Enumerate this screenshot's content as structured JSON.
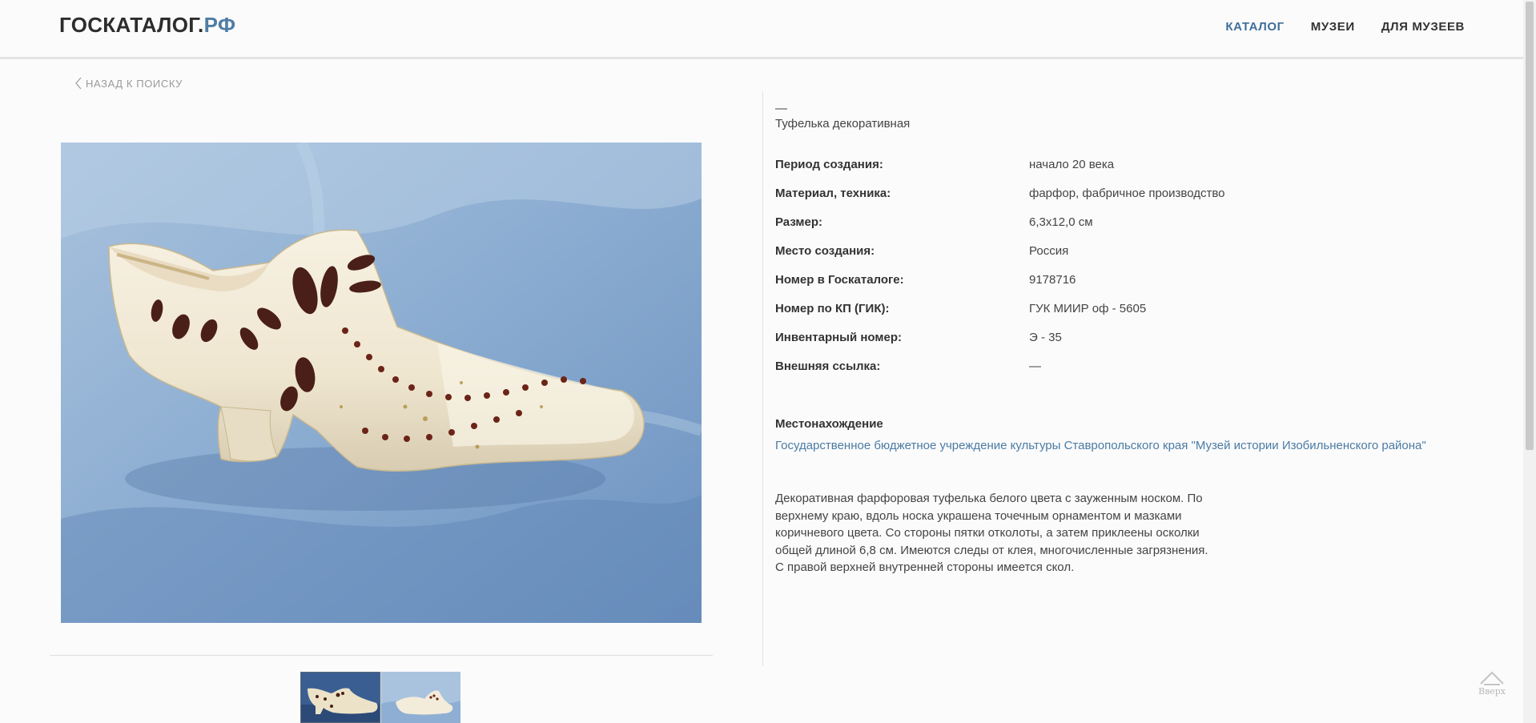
{
  "header": {
    "logo_main": "ГОСКАТАЛОГ.",
    "logo_accent": "РФ",
    "nav": [
      {
        "label": "КАТАЛОГ",
        "active": true
      },
      {
        "label": "МУЗЕИ",
        "active": false
      },
      {
        "label": "ДЛЯ МУЗЕЕВ",
        "active": false
      }
    ]
  },
  "back_link": "НАЗАД К ПОИСКУ",
  "object": {
    "dash": "—",
    "title": "Туфелька декоративная",
    "properties": [
      {
        "label": "Период создания:",
        "value": "начало 20 века"
      },
      {
        "label": "Материал, техника:",
        "value": "фарфор, фабричное производство"
      },
      {
        "label": "Размер:",
        "value": "6,3x12,0 см"
      },
      {
        "label": "Место создания:",
        "value": "Россия"
      },
      {
        "label": "Номер в Госкаталоге:",
        "value": "9178716"
      },
      {
        "label": "Номер по КП (ГИК):",
        "value": "ГУК МИИР оф - 5605"
      },
      {
        "label": "Инвентарный номер:",
        "value": "Э - 35"
      },
      {
        "label": "Внешняя ссылка:",
        "value": "—"
      }
    ],
    "location_heading": "Местонахождение",
    "location_link": "Государственное бюджетное учреждение культуры Ставропольского края \"Музей истории Изобильненского района\"",
    "description_lines": [
      "Декоративная фарфоровая туфелька белого цвета с зауженным носком. По",
      "верхнему краю, вдоль носка украшена точечным орнаментом и мазками",
      "коричневого цвета. Со стороны пятки отколоты, а затем приклеены осколки",
      "общей длиной 6,8 см. Имеются следы от клея, многочисленные загрязнения.",
      "С правой верхней внутренней стороны имеется скол."
    ]
  },
  "to_top_label": "Вверх",
  "colors": {
    "accent": "#4b7ba3",
    "nav_active": "#3f6f98",
    "photo_background": "#8fb0d2",
    "porcelain": "#f1ead8",
    "ornament": "#4a1f17"
  }
}
